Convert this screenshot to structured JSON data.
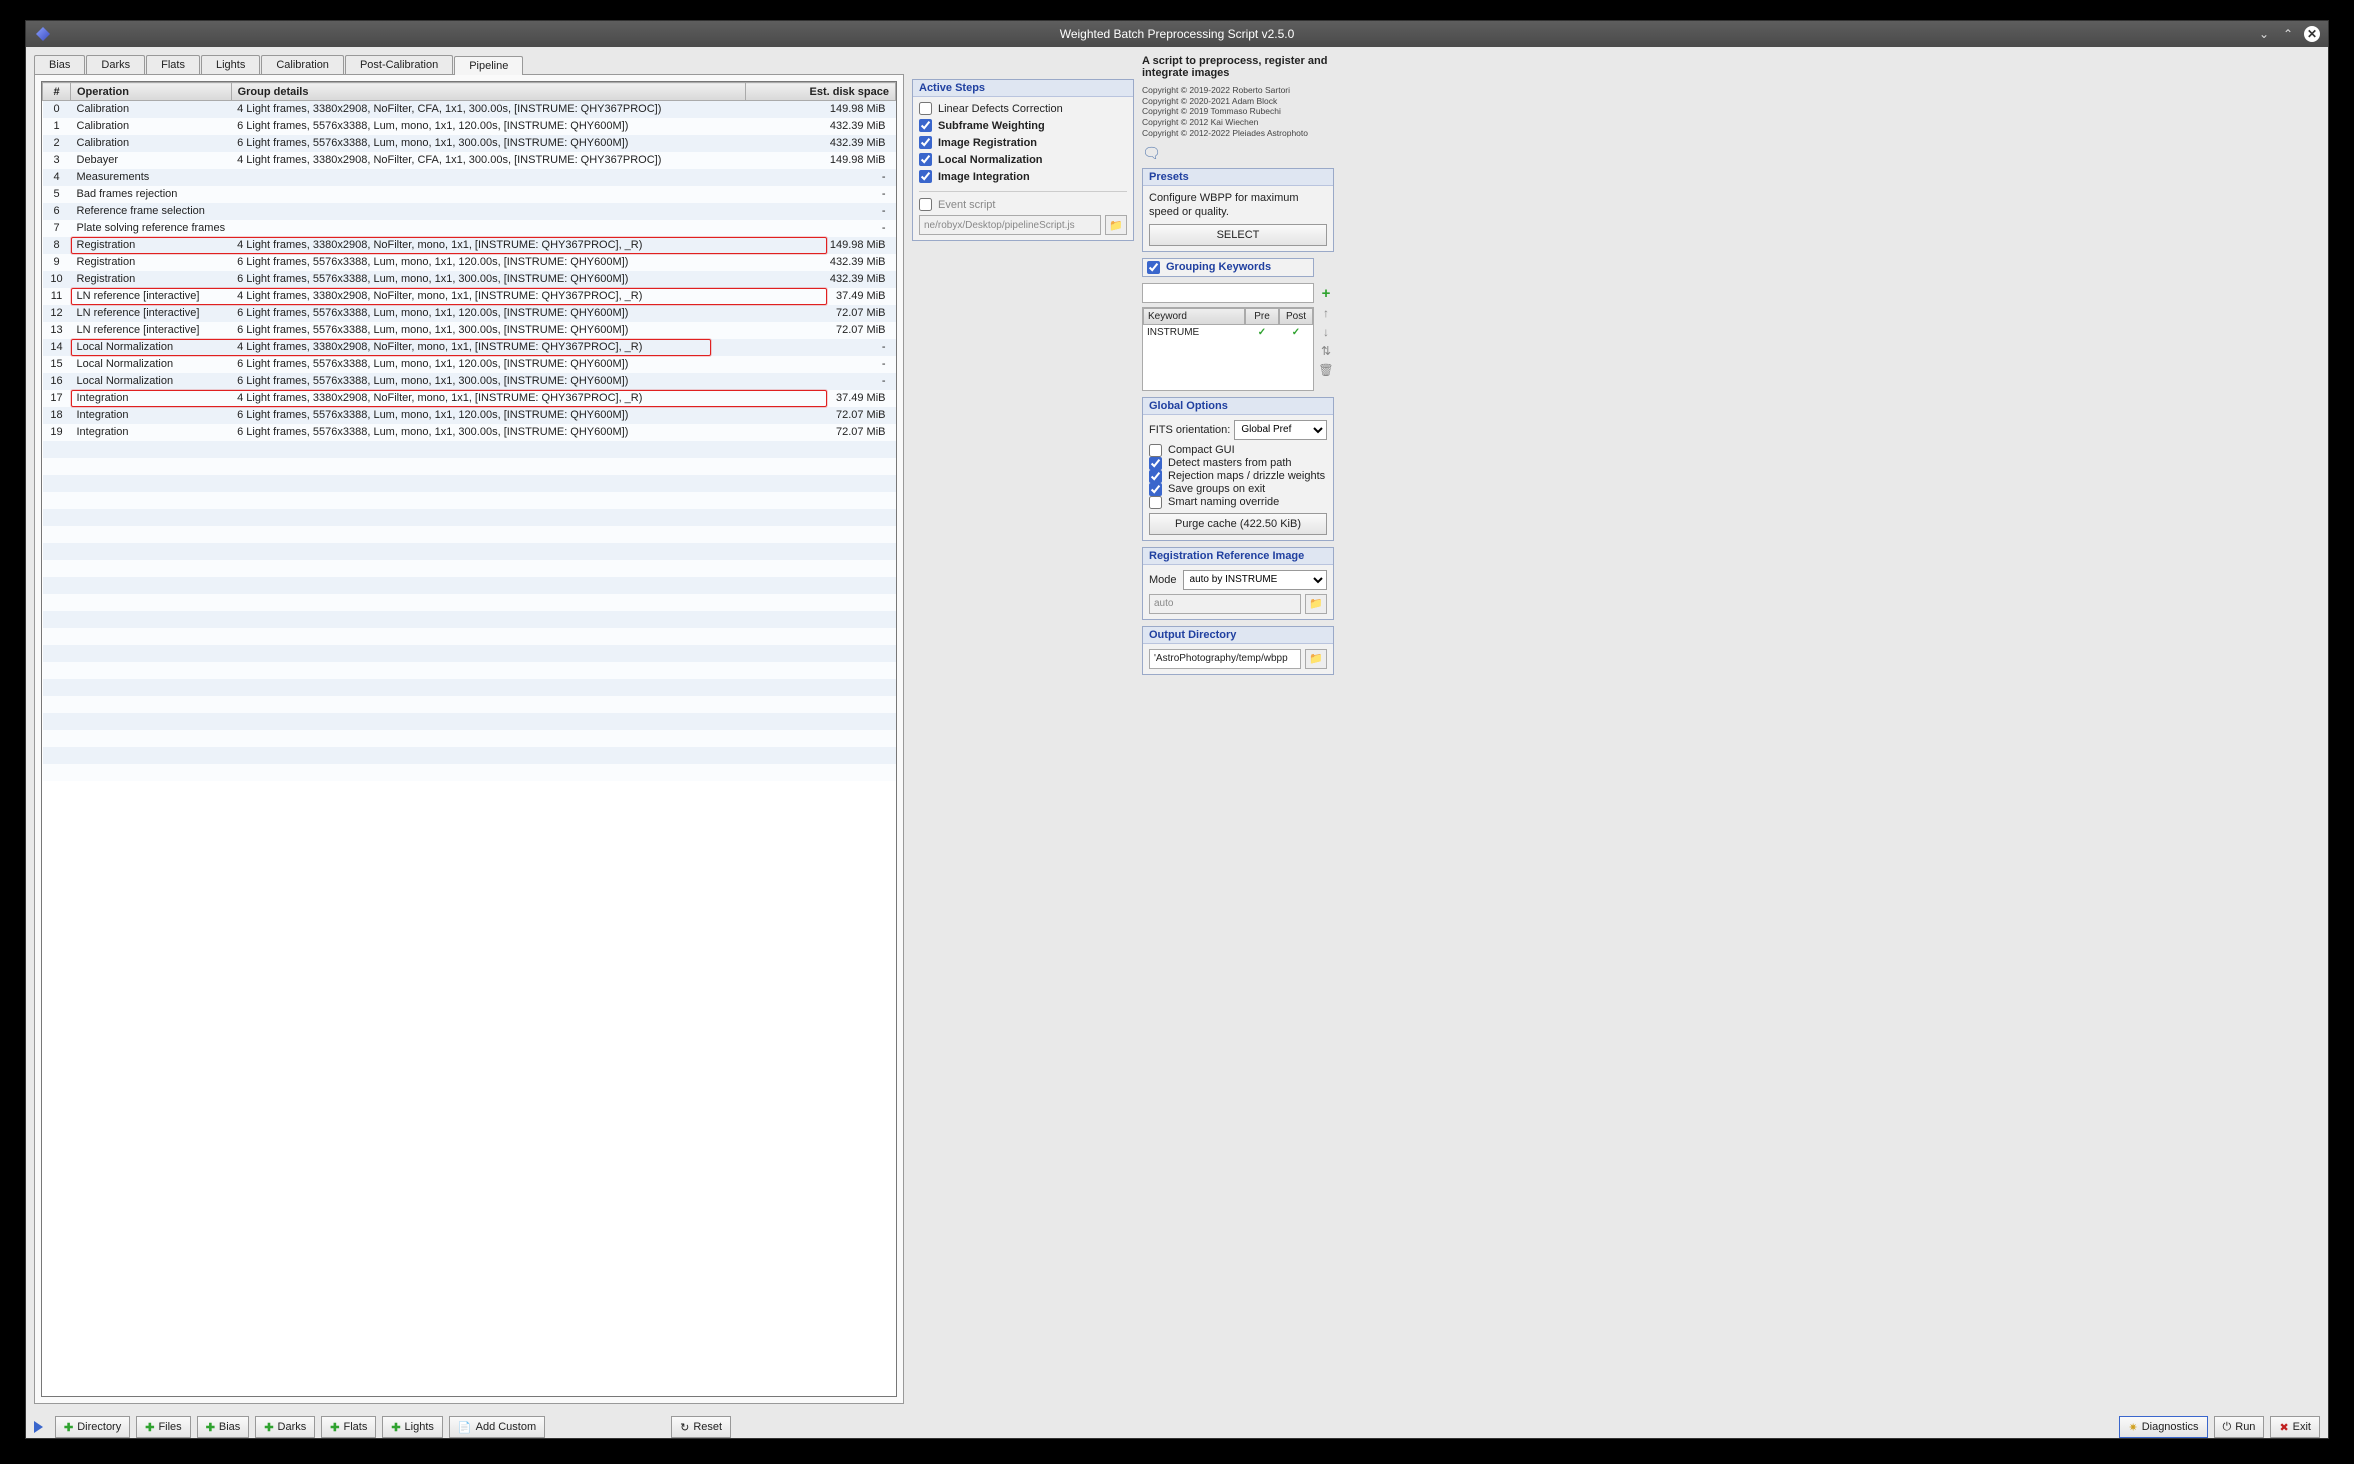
{
  "window": {
    "title": "Weighted Batch Preprocessing Script v2.5.0"
  },
  "tabs": [
    "Bias",
    "Darks",
    "Flats",
    "Lights",
    "Calibration",
    "Post-Calibration",
    "Pipeline"
  ],
  "active_tab": 6,
  "table": {
    "headers": {
      "num": "#",
      "op": "Operation",
      "details": "Group details",
      "est": "Est. disk space"
    },
    "rows": [
      {
        "n": "0",
        "op": "Calibration",
        "d": "4 Light frames, 3380x2908, NoFilter, CFA, 1x1, 300.00s, [INSTRUME: QHY367PROC])",
        "e": "149.98 MiB"
      },
      {
        "n": "1",
        "op": "Calibration",
        "d": "6 Light frames, 5576x3388, Lum, mono, 1x1, 120.00s, [INSTRUME: QHY600M])",
        "e": "432.39 MiB"
      },
      {
        "n": "2",
        "op": "Calibration",
        "d": "6 Light frames, 5576x3388, Lum, mono, 1x1, 300.00s, [INSTRUME: QHY600M])",
        "e": "432.39 MiB"
      },
      {
        "n": "3",
        "op": "Debayer",
        "d": "4 Light frames, 3380x2908, NoFilter, CFA, 1x1, 300.00s, [INSTRUME: QHY367PROC])",
        "e": "149.98 MiB"
      },
      {
        "n": "4",
        "op": "Measurements",
        "d": "",
        "e": "-"
      },
      {
        "n": "5",
        "op": "Bad frames rejection",
        "d": "",
        "e": "-"
      },
      {
        "n": "6",
        "op": "Reference frame selection",
        "d": "",
        "e": "-"
      },
      {
        "n": "7",
        "op": "Plate solving reference frames",
        "d": "",
        "e": "-"
      },
      {
        "n": "8",
        "op": "Registration",
        "d": "4 Light frames, 3380x2908, NoFilter, mono, 1x1, [INSTRUME: QHY367PROC], _R)",
        "e": "149.98 MiB",
        "hl": true
      },
      {
        "n": "9",
        "op": "Registration",
        "d": "6 Light frames, 5576x3388, Lum, mono, 1x1, 120.00s, [INSTRUME: QHY600M])",
        "e": "432.39 MiB"
      },
      {
        "n": "10",
        "op": "Registration",
        "d": "6 Light frames, 5576x3388, Lum, mono, 1x1, 300.00s, [INSTRUME: QHY600M])",
        "e": "432.39 MiB"
      },
      {
        "n": "11",
        "op": "LN reference [interactive]",
        "d": "4 Light frames, 3380x2908, NoFilter, mono, 1x1, [INSTRUME: QHY367PROC], _R)",
        "e": "37.49 MiB",
        "hl": true
      },
      {
        "n": "12",
        "op": "LN reference [interactive]",
        "d": "6 Light frames, 5576x3388, Lum, mono, 1x1, 120.00s, [INSTRUME: QHY600M])",
        "e": "72.07 MiB"
      },
      {
        "n": "13",
        "op": "LN reference [interactive]",
        "d": "6 Light frames, 5576x3388, Lum, mono, 1x1, 300.00s, [INSTRUME: QHY600M])",
        "e": "72.07 MiB"
      },
      {
        "n": "14",
        "op": "Local Normalization",
        "d": "4 Light frames, 3380x2908, NoFilter, mono, 1x1, [INSTRUME: QHY367PROC], _R)",
        "e": "-",
        "hl": true,
        "hlshort": true
      },
      {
        "n": "15",
        "op": "Local Normalization",
        "d": "6 Light frames, 5576x3388, Lum, mono, 1x1, 120.00s, [INSTRUME: QHY600M])",
        "e": "-"
      },
      {
        "n": "16",
        "op": "Local Normalization",
        "d": "6 Light frames, 5576x3388, Lum, mono, 1x1, 300.00s, [INSTRUME: QHY600M])",
        "e": "-"
      },
      {
        "n": "17",
        "op": "Integration",
        "d": "4 Light frames, 3380x2908, NoFilter, mono, 1x1, [INSTRUME: QHY367PROC], _R)",
        "e": "37.49 MiB",
        "hl": true
      },
      {
        "n": "18",
        "op": "Integration",
        "d": "6 Light frames, 5576x3388, Lum, mono, 1x1, 120.00s, [INSTRUME: QHY600M])",
        "e": "72.07 MiB"
      },
      {
        "n": "19",
        "op": "Integration",
        "d": "6 Light frames, 5576x3388, Lum, mono, 1x1, 300.00s, [INSTRUME: QHY600M])",
        "e": "72.07 MiB"
      }
    ]
  },
  "active_steps": {
    "title": "Active Steps",
    "items": [
      {
        "label": "Linear Defects Correction",
        "checked": false,
        "bold": false
      },
      {
        "label": "Subframe Weighting",
        "checked": true,
        "bold": true
      },
      {
        "label": "Image Registration",
        "checked": true,
        "bold": true
      },
      {
        "label": "Local Normalization",
        "checked": true,
        "bold": true
      },
      {
        "label": "Image Integration",
        "checked": true,
        "bold": true
      }
    ],
    "event_label": "Event script",
    "event_path": "ne/robyx/Desktop/pipelineScript.js"
  },
  "description": {
    "title": "A script to preprocess, register and integrate images",
    "copyright": [
      "Copyright © 2019-2022 Roberto Sartori",
      "Copyright © 2020-2021 Adam Block",
      "Copyright © 2019 Tommaso Rubechi",
      "Copyright © 2012 Kai Wiechen",
      "Copyright © 2012-2022 Pleiades Astrophoto"
    ]
  },
  "presets": {
    "title": "Presets",
    "text": "Configure WBPP for maximum speed or quality.",
    "button": "SELECT"
  },
  "grouping": {
    "label": "Grouping Keywords",
    "headers": {
      "k": "Keyword",
      "pre": "Pre",
      "post": "Post"
    },
    "row": {
      "k": "INSTRUME",
      "pre": "✓",
      "post": "✓"
    }
  },
  "global": {
    "title": "Global Options",
    "fits_label": "FITS orientation:",
    "fits_value": "Global Pref",
    "items": [
      {
        "label": "Compact GUI",
        "checked": false
      },
      {
        "label": "Detect masters from path",
        "checked": true
      },
      {
        "label": "Rejection maps / drizzle weights",
        "checked": true
      },
      {
        "label": "Save groups on exit",
        "checked": true
      },
      {
        "label": "Smart naming override",
        "checked": false
      }
    ],
    "purge": "Purge cache (422.50 KiB)"
  },
  "regref": {
    "title": "Registration Reference Image",
    "mode_label": "Mode",
    "mode_value": "auto by INSTRUME",
    "auto": "auto"
  },
  "output": {
    "title": "Output Directory",
    "path": "'AstroPhotography/temp/wbpp"
  },
  "footer": {
    "directory": "Directory",
    "files": "Files",
    "bias": "Bias",
    "darks": "Darks",
    "flats": "Flats",
    "lights": "Lights",
    "custom": "Add Custom",
    "reset": "Reset",
    "diag": "Diagnostics",
    "run": "Run",
    "exit": "Exit"
  }
}
